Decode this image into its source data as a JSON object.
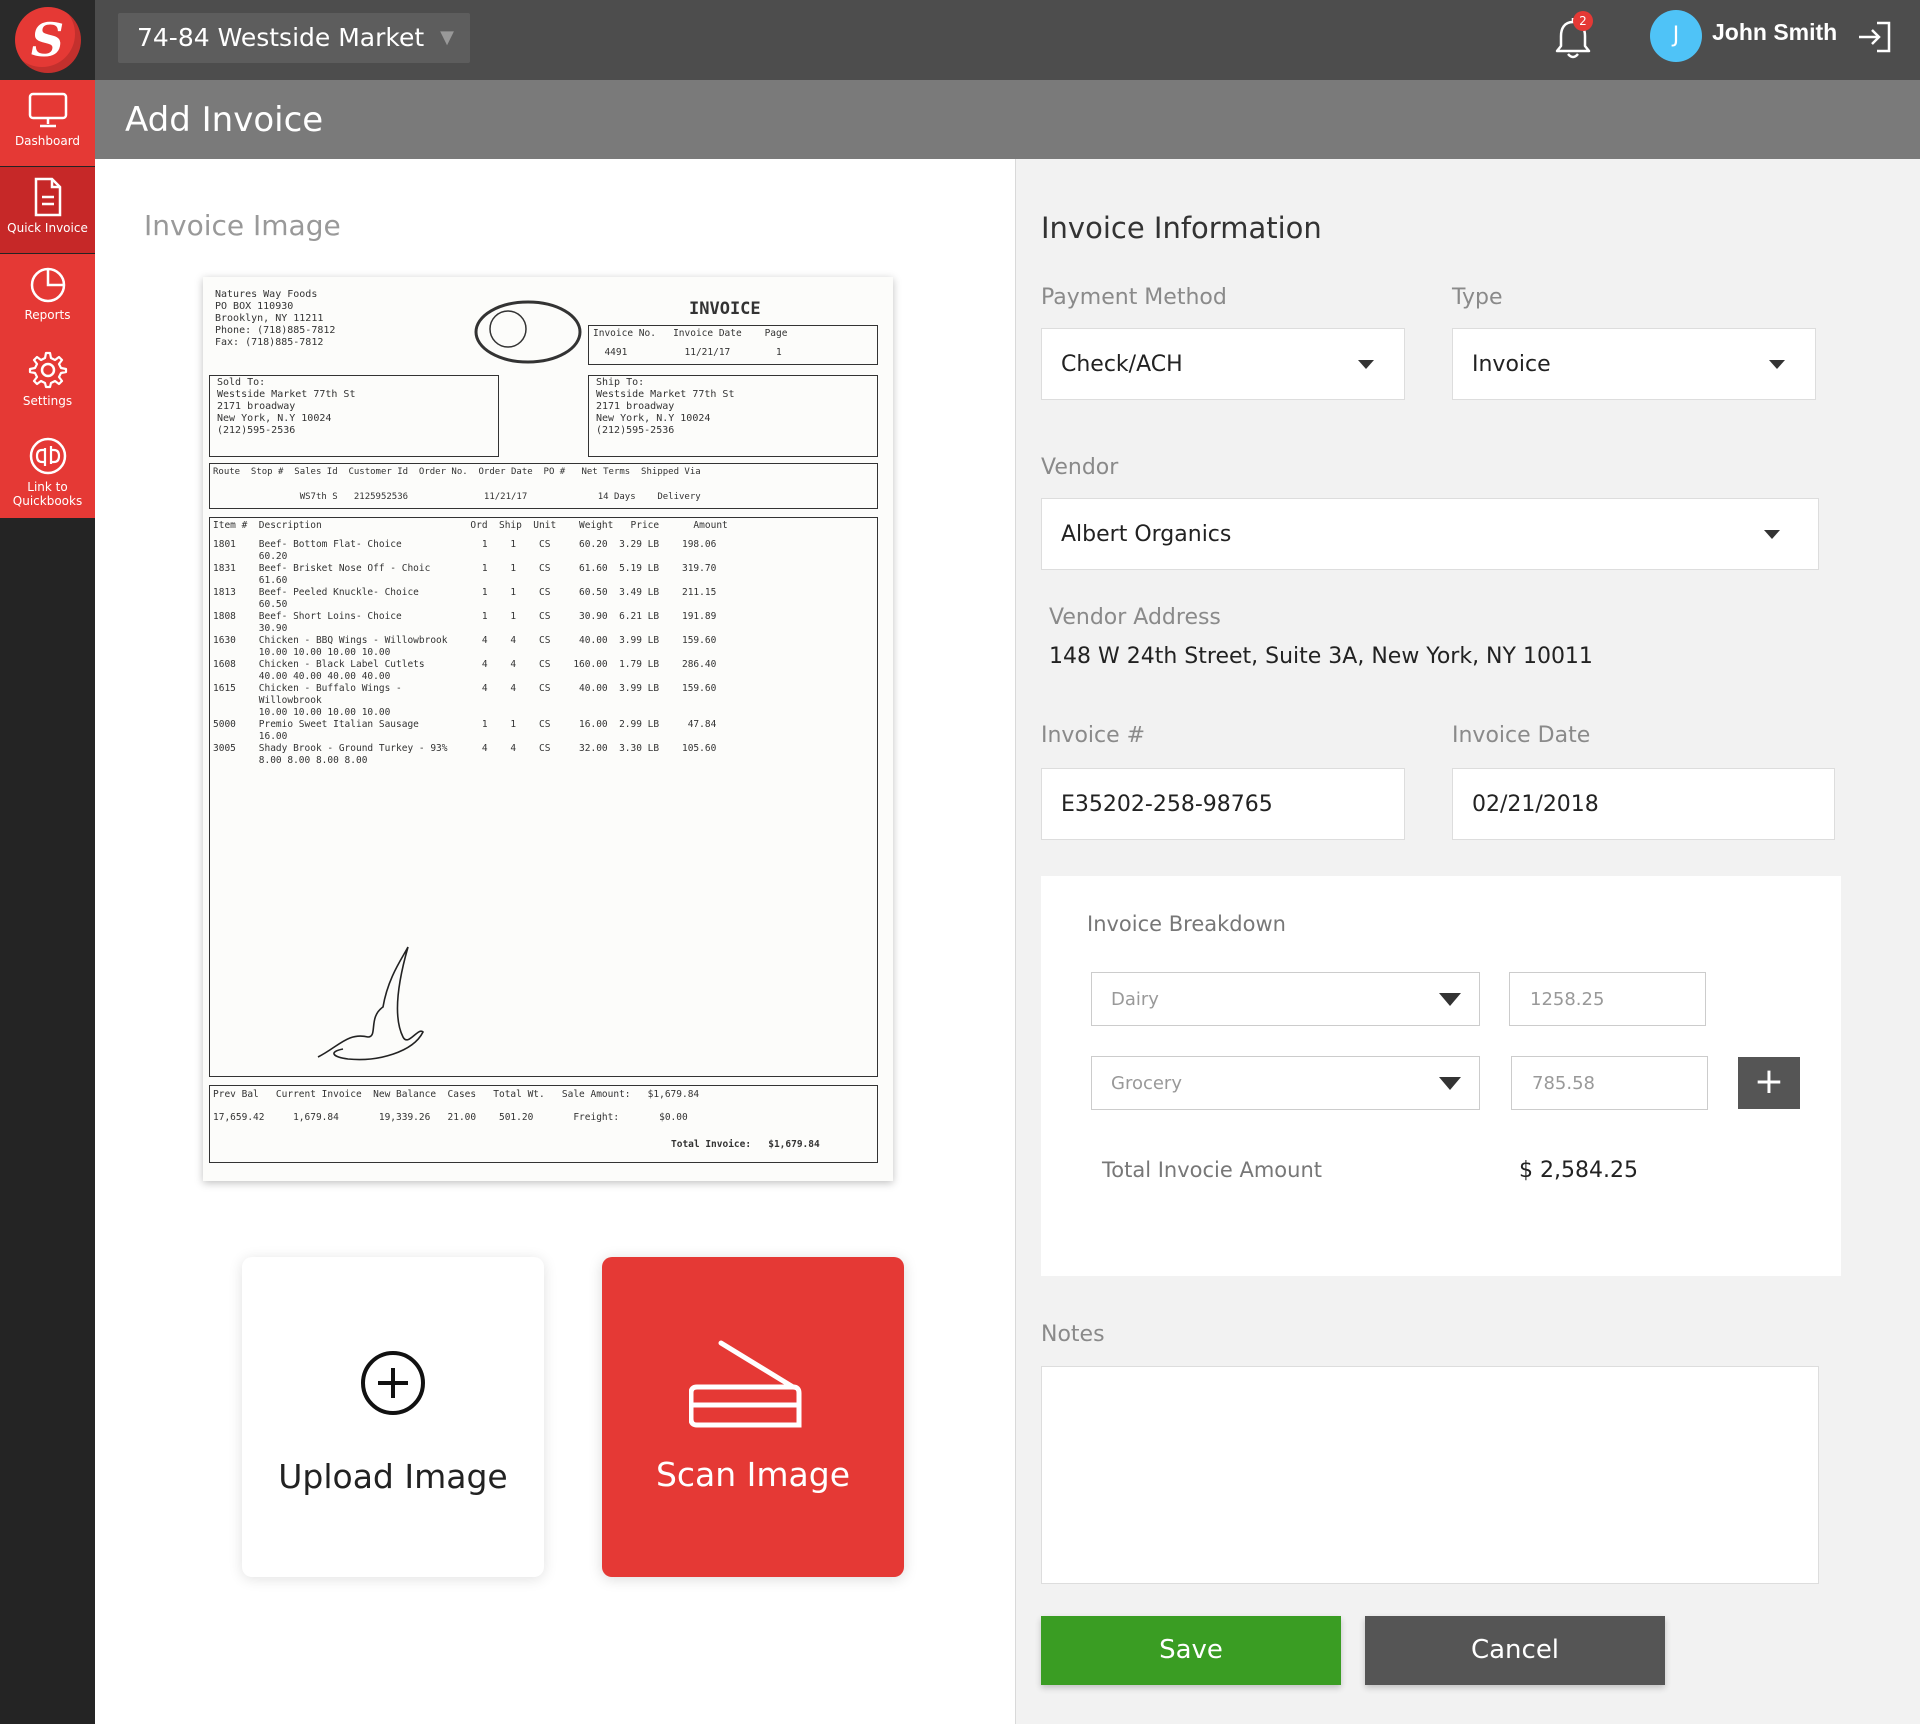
{
  "app": {
    "logo_letter": "S",
    "store_name": "74-84 Westside Market",
    "notification_count": "2",
    "user_initial": "J",
    "user_name": "John Smith"
  },
  "sidebar": {
    "items": [
      {
        "label": "Dashboard",
        "icon": "monitor-icon"
      },
      {
        "label": "Quick Invoice",
        "icon": "document-icon"
      },
      {
        "label": "Reports",
        "icon": "pie-chart-icon"
      },
      {
        "label": "Settings",
        "icon": "gear-icon"
      },
      {
        "label": "Link to Quickbooks",
        "icon": "quickbooks-icon"
      }
    ]
  },
  "header": {
    "title": "Add Invoice"
  },
  "left": {
    "section_title": "Invoice Image",
    "upload_label": "Upload Image",
    "scan_label": "Scan Image"
  },
  "invoice_doc": {
    "company": "Natures Way Foods\nPO BOX 110930\nBrooklyn, NY 11211\nPhone: (718)885-7812\nFax: (718)885-7812",
    "title": "INVOICE",
    "hdr": "Invoice No.   Invoice Date    Page",
    "hdr_vals": "  4491          11/21/17        1",
    "sold_to": "Sold To:\nWestside Market 77th St\n2171 broadway\nNew York, N.Y 10024\n(212)595-2536",
    "ship_to": "Ship To:\nWestside Market 77th St\n2171 broadway\nNew York, N.Y 10024\n(212)595-2536",
    "meta_hdr": "Route  Stop #  Sales Id  Customer Id  Order No.  Order Date  PO #   Net Terms  Shipped Via",
    "meta_vals": "                WS7th S   2125952536              11/21/17             14 Days    Delivery",
    "lines_hdr": "Item #  Description                          Ord  Ship  Unit    Weight   Price      Amount",
    "lines": "1801    Beef- Bottom Flat- Choice              1    1    CS     60.20  3.29 LB    198.06\n        60.20\n1831    Beef- Brisket Nose Off - Choic         1    1    CS     61.60  5.19 LB    319.70\n        61.60\n1813    Beef- Peeled Knuckle- Choice           1    1    CS     60.50  3.49 LB    211.15\n        60.50\n1808    Beef- Short Loins- Choice              1    1    CS     30.90  6.21 LB    191.89\n        30.90\n1630    Chicken - BBQ Wings - Willowbrook      4    4    CS     40.00  3.99 LB    159.60\n        10.00 10.00 10.00 10.00\n1608    Chicken - Black Label Cutlets          4    4    CS    160.00  1.79 LB    286.40\n        40.00 40.00 40.00 40.00\n1615    Chicken - Buffalo Wings -              4    4    CS     40.00  3.99 LB    159.60\n        Willowbrook\n        10.00 10.00 10.00 10.00\n5000    Premio Sweet Italian Sausage           1    1    CS     16.00  2.99 LB     47.84\n        16.00\n3005    Shady Brook - Ground Turkey - 93%      4    4    CS     32.00  3.30 LB    105.60\n        8.00 8.00 8.00 8.00",
    "totals_hdr": "Prev Bal   Current Invoice  New Balance  Cases   Total Wt.   Sale Amount:   $1,679.84",
    "totals_vals": "17,659.42     1,679.84       19,339.26   21.00    501.20       Freight:       $0.00",
    "total_invoice": "Total Invoice:   $1,679.84"
  },
  "form": {
    "section_title": "Invoice Information",
    "payment_method_label": "Payment Method",
    "payment_method_value": "Check/ACH",
    "type_label": "Type",
    "type_value": "Invoice",
    "vendor_label": "Vendor",
    "vendor_value": "Albert Organics",
    "vendor_address_label": "Vendor Address",
    "vendor_address_value": "148 W 24th Street, Suite 3A, New York, NY 10011",
    "invoice_no_label": "Invoice #",
    "invoice_no_value": "E35202-258-98765",
    "invoice_date_label": "Invoice Date",
    "invoice_date_value": "02/21/2018",
    "breakdown": {
      "title": "Invoice Breakdown",
      "rows": [
        {
          "category": "Dairy",
          "amount": "1258.25"
        },
        {
          "category": "Grocery",
          "amount": "785.58"
        }
      ],
      "add_label": "+",
      "total_label": "Total Invocie Amount",
      "total_value": "$ 2,584.25"
    },
    "notes_label": "Notes",
    "save_label": "Save",
    "cancel_label": "Cancel"
  },
  "colors": {
    "brand_red": "#e53935",
    "save_green": "#3a9d23",
    "topbar": "#4d4d4d"
  }
}
